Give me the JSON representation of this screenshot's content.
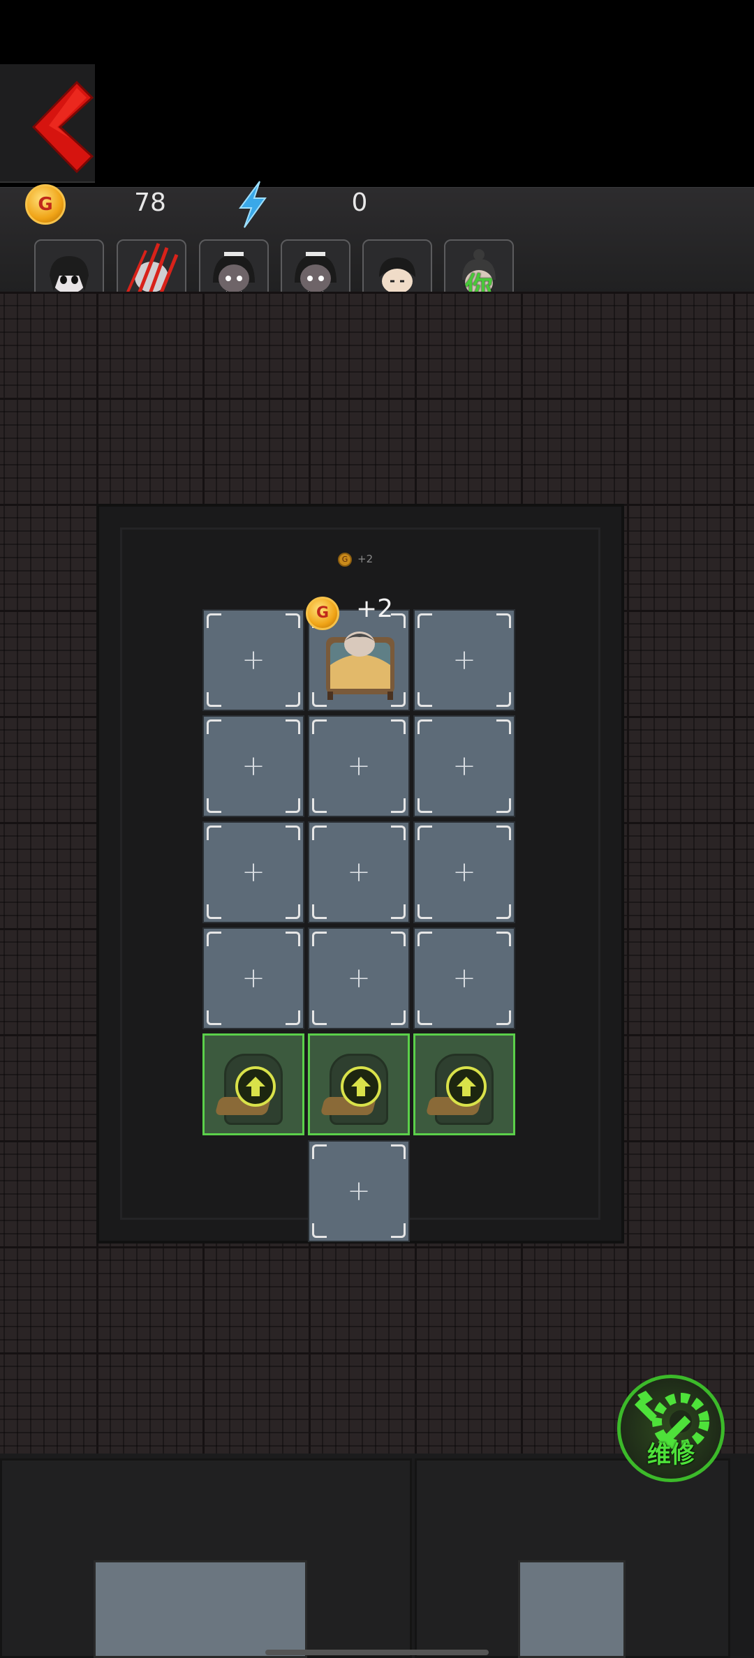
{
  "hud": {
    "gold_icon": "G",
    "gold": "78",
    "energy_icon": "lightning-icon",
    "energy": "0"
  },
  "players": [
    {
      "name": "ghost-girl",
      "label": ""
    },
    {
      "name": "clawed-player",
      "label": ""
    },
    {
      "name": "maid-girl-1",
      "label": ""
    },
    {
      "name": "maid-girl-2",
      "label": ""
    },
    {
      "name": "boy",
      "label": ""
    },
    {
      "name": "you",
      "label": "你"
    }
  ],
  "room": {
    "floating_income_icon": "G",
    "floating_income": "+2",
    "gain_icon": "G",
    "gain_text": "+2",
    "empty_slot_symbol": "+"
  },
  "actions": {
    "repair_label": "维修"
  },
  "colors": {
    "accent_green": "#4ee23a",
    "back_red": "#d6140f",
    "gold": "#f0a417",
    "energy_blue": "#3aa8e8"
  }
}
